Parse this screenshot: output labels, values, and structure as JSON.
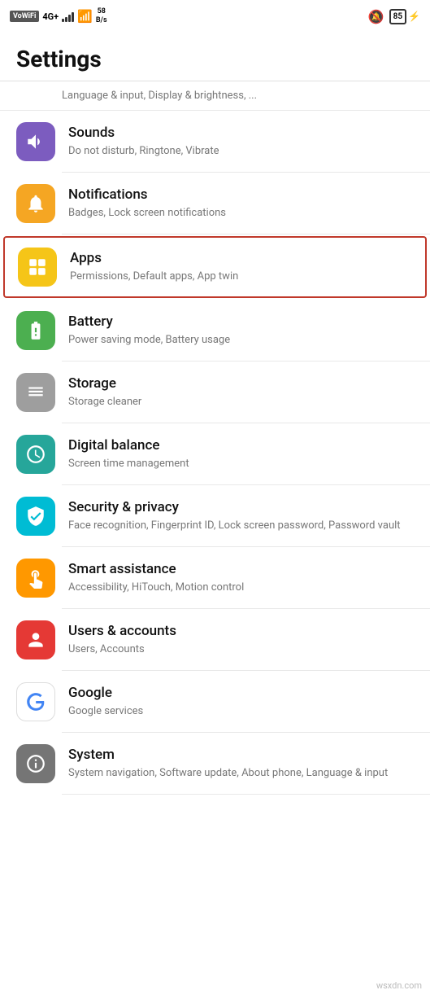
{
  "statusBar": {
    "vowifi": "VoWiFi",
    "signal": "4G+",
    "speed": "58\nB/s",
    "batteryPct": "85",
    "chargingSymbol": "⚡"
  },
  "pageTitle": "Settings",
  "items": [
    {
      "id": "sounds",
      "title": "Sounds",
      "subtitle": "Do not disturb, Ringtone, Vibrate",
      "iconColor": "icon-purple",
      "iconSymbol": "🔊",
      "highlighted": false
    },
    {
      "id": "notifications",
      "title": "Notifications",
      "subtitle": "Badges, Lock screen notifications",
      "iconColor": "icon-yellow",
      "iconSymbol": "🔔",
      "highlighted": false
    },
    {
      "id": "apps",
      "title": "Apps",
      "subtitle": "Permissions, Default apps, App twin",
      "iconColor": "icon-yellow2",
      "iconSymbol": "⊞",
      "highlighted": true
    },
    {
      "id": "battery",
      "title": "Battery",
      "subtitle": "Power saving mode, Battery usage",
      "iconColor": "icon-green",
      "iconSymbol": "🔋",
      "highlighted": false
    },
    {
      "id": "storage",
      "title": "Storage",
      "subtitle": "Storage cleaner",
      "iconColor": "icon-gray",
      "iconSymbol": "☰",
      "highlighted": false
    },
    {
      "id": "digital-balance",
      "title": "Digital balance",
      "subtitle": "Screen time management",
      "iconColor": "icon-teal",
      "iconSymbol": "⏳",
      "highlighted": false
    },
    {
      "id": "security-privacy",
      "title": "Security & privacy",
      "subtitle": "Face recognition, Fingerprint ID, Lock screen password, Password vault",
      "iconColor": "icon-cyan",
      "iconSymbol": "🛡",
      "highlighted": false
    },
    {
      "id": "smart-assistance",
      "title": "Smart assistance",
      "subtitle": "Accessibility, HiTouch, Motion control",
      "iconColor": "icon-orange",
      "iconSymbol": "✋",
      "highlighted": false
    },
    {
      "id": "users-accounts",
      "title": "Users & accounts",
      "subtitle": "Users, Accounts",
      "iconColor": "icon-red",
      "iconSymbol": "👤",
      "highlighted": false
    },
    {
      "id": "google",
      "title": "Google",
      "subtitle": "Google services",
      "iconColor": "icon-google",
      "iconSymbol": "G",
      "highlighted": false
    },
    {
      "id": "system",
      "title": "System",
      "subtitle": "System navigation, Software update, About phone, Language & input",
      "iconColor": "icon-darkgray",
      "iconSymbol": "ℹ",
      "highlighted": false
    }
  ]
}
